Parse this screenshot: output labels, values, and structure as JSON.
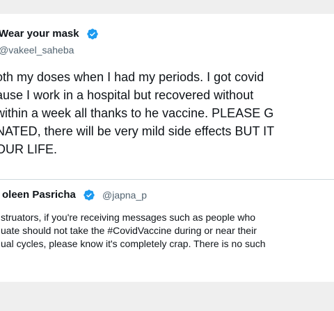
{
  "tweet": {
    "display_name": "Wear your mask",
    "handle": "@vakeel_saheba",
    "verified_icon": "verified-badge",
    "verified_color": "#1d9bf0",
    "text_lines": [
      "oth my doses when I had my periods. I got covid",
      "ause I work in a hospital but recovered without",
      " within a week all thanks to he vaccine. PLEASE G",
      "NATED, there will be very mild side effects BUT IT",
      "OUR LIFE."
    ]
  },
  "quoted_tweet": {
    "display_name": "oleen Pasricha",
    "handle": "@japna_p",
    "verified_icon": "verified-badge",
    "text_lines": [
      "struators, if you're receiving messages such as people who",
      "uate should not take the #CovidVaccine during or near their",
      "ual cycles, please know it's completely crap. There is no such"
    ]
  }
}
